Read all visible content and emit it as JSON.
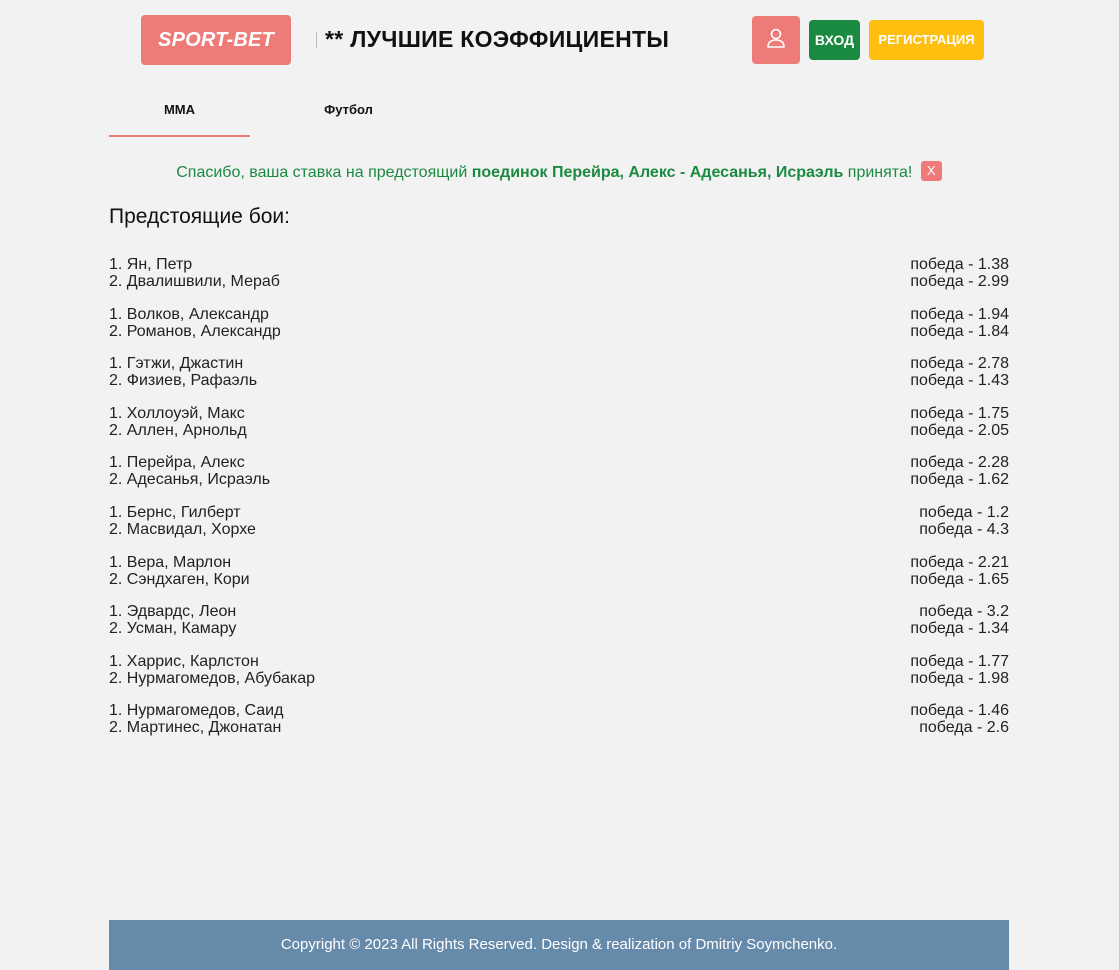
{
  "header": {
    "logo_text": "SPORT-BET",
    "title": "** ЛУЧШИЕ КОЭФФИЦИЕНТЫ",
    "user_icon": "user-icon",
    "login_label": "ВХОД",
    "register_label": "РЕГИСТРАЦИЯ"
  },
  "tabs": [
    {
      "label": "MMA",
      "active": true
    },
    {
      "label": "Футбол",
      "active": false
    }
  ],
  "notice": {
    "prefix": "Спасибо, ваша ставка на предстоящий ",
    "bold": "поединок Перейра, Алекс - Адесанья, Исраэль",
    "suffix": " принята!",
    "close_label": "X"
  },
  "section_heading": "Предстоящие бои:",
  "fights": [
    {
      "f1": "1. Ян, Петр",
      "o1": "победа - 1.38",
      "f2": "2. Двалишвили, Мераб",
      "o2": "победа - 2.99"
    },
    {
      "f1": "1. Волков, Александр",
      "o1": "победа - 1.94",
      "f2": "2. Романов, Александр",
      "o2": "победа - 1.84"
    },
    {
      "f1": "1. Гэтжи, Джастин",
      "o1": "победа - 2.78",
      "f2": "2. Физиев, Рафаэль",
      "o2": "победа - 1.43"
    },
    {
      "f1": "1. Холлоуэй, Макс",
      "o1": "победа - 1.75",
      "f2": "2. Аллен, Арнольд",
      "o2": "победа - 2.05"
    },
    {
      "f1": "1. Перейра, Алекс",
      "o1": "победа - 2.28",
      "f2": "2. Адесанья, Исраэль",
      "o2": "победа - 1.62"
    },
    {
      "f1": "1. Бернс, Гилберт",
      "o1": "победа - 1.2",
      "f2": "2. Масвидал, Хорхе",
      "o2": "победа - 4.3"
    },
    {
      "f1": "1. Вера, Марлон",
      "o1": "победа - 2.21",
      "f2": "2. Сэндхаген, Кори",
      "o2": "победа - 1.65"
    },
    {
      "f1": "1. Эдвардс, Леон",
      "o1": "победа - 3.2",
      "f2": "2. Усман, Камару",
      "o2": "победа - 1.34"
    },
    {
      "f1": "1. Харрис, Карлстон",
      "o1": "победа - 1.77",
      "f2": "2. Нурмагомедов, Абубакар",
      "o2": "победа - 1.98"
    },
    {
      "f1": "1. Нурмагомедов, Саид",
      "o1": "победа - 1.46",
      "f2": "2. Мартинес, Джонатан",
      "o2": "победа - 2.6"
    }
  ],
  "footer": {
    "text": "Copyright © 2023 All Rights Reserved. Design & realization of Dmitriy Soymchenko."
  }
}
